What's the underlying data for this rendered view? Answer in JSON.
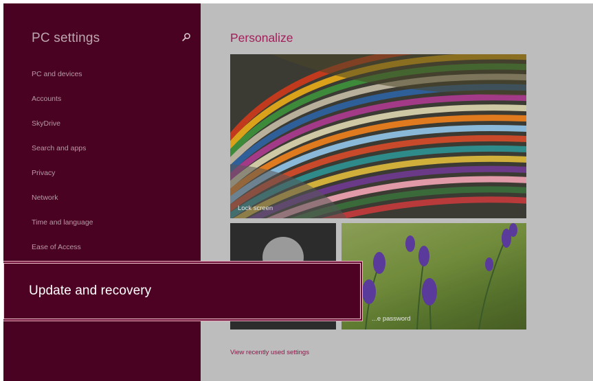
{
  "sidebar": {
    "title": "PC settings",
    "items": [
      {
        "label": "PC and devices"
      },
      {
        "label": "Accounts"
      },
      {
        "label": "SkyDrive"
      },
      {
        "label": "Search and apps"
      },
      {
        "label": "Privacy"
      },
      {
        "label": "Network"
      },
      {
        "label": "Time and language"
      },
      {
        "label": "Ease of Access"
      }
    ],
    "selected_item": "Update and recovery"
  },
  "main": {
    "title": "Personalize",
    "tiles": {
      "lock_screen": "Lock screen",
      "password": "...e password"
    },
    "recent_link": "View recently used settings"
  },
  "icons": {
    "search": "search-icon"
  },
  "colors": {
    "sidebar_bg": "#4a0222",
    "accent": "#a0205a",
    "highlight_border": "#f6c6d4"
  }
}
